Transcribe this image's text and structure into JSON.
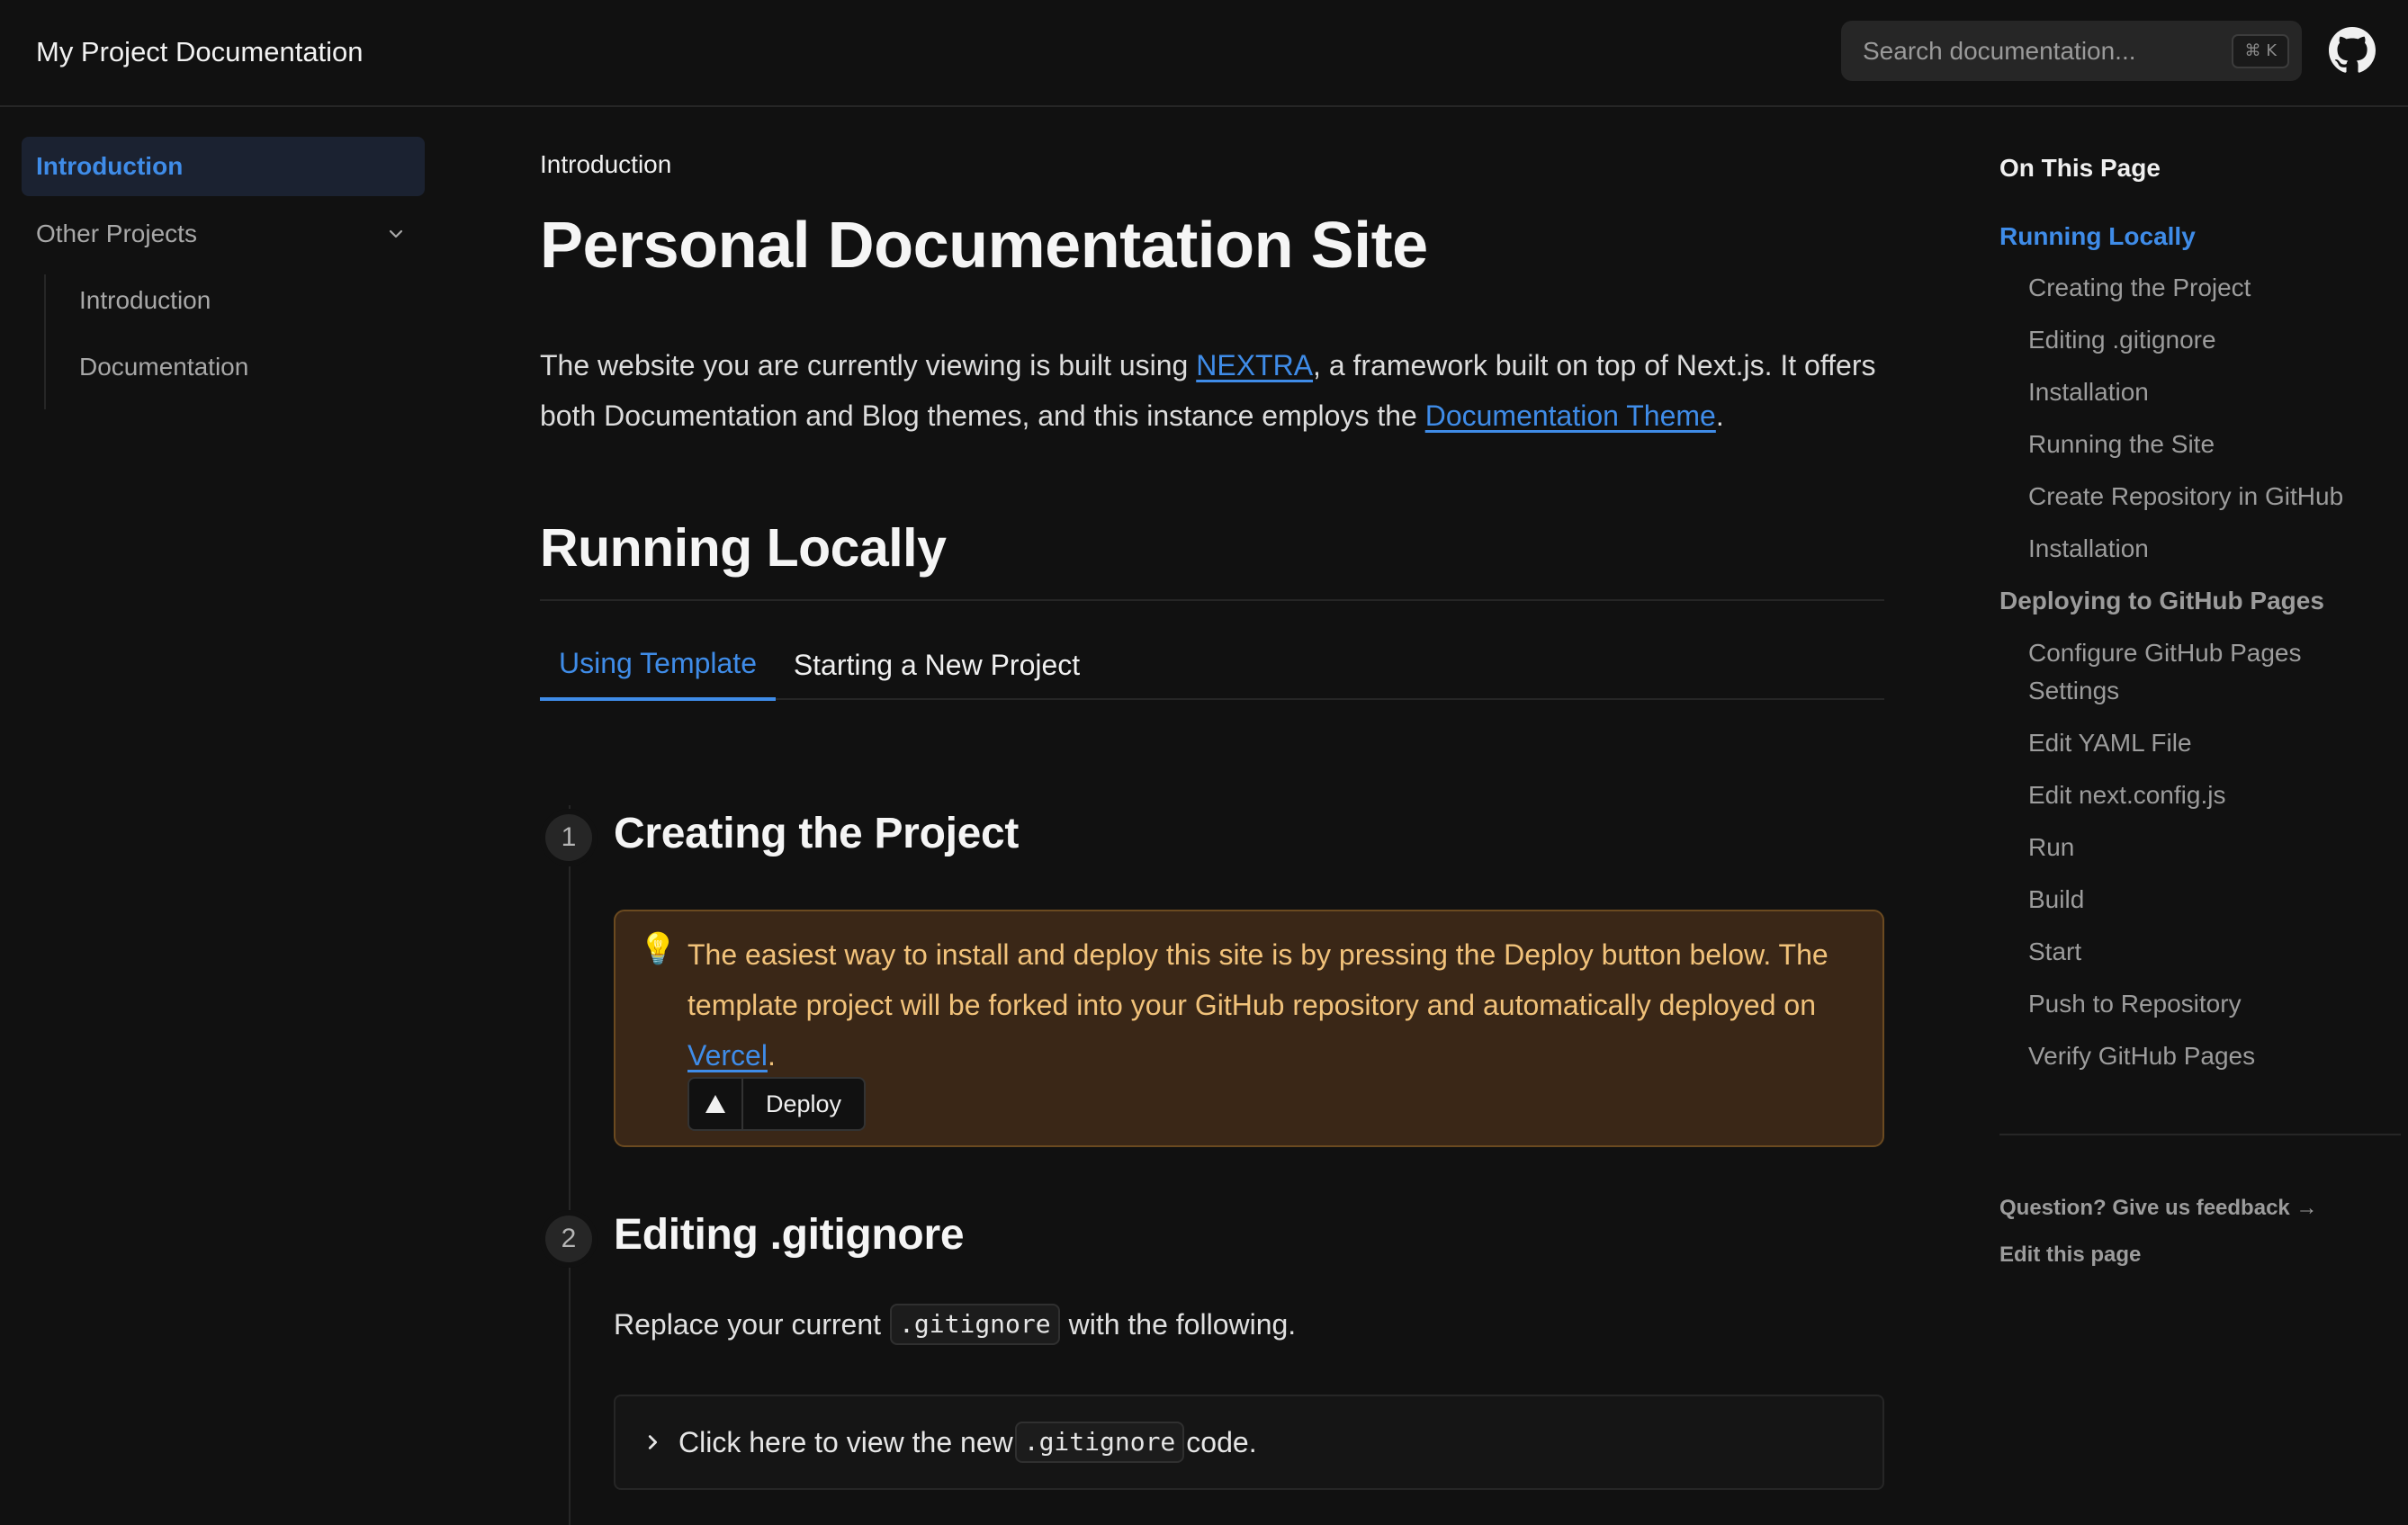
{
  "navbar": {
    "site_title": "My Project Documentation",
    "search_placeholder": "Search documentation...",
    "search_shortcut": "⌘ K",
    "github_icon": "github-icon"
  },
  "sidebar": {
    "items": [
      {
        "label": "Introduction",
        "active": true
      },
      {
        "label": "Other Projects",
        "expandable": true,
        "expanded": true,
        "children": [
          {
            "label": "Introduction"
          },
          {
            "label": "Documentation"
          }
        ]
      }
    ]
  },
  "main": {
    "breadcrumb": "Introduction",
    "title": "Personal Documentation Site",
    "intro": {
      "part1": "The website you are currently viewing is built using ",
      "link1": "NEXTRA",
      "part2": ", a framework built on top of Next.js. It offers both Documentation and Blog themes, and this instance employs the ",
      "link2": "Documentation Theme",
      "part3": "."
    },
    "section_title": "Running Locally",
    "tabs": [
      {
        "label": "Using Template",
        "active": true
      },
      {
        "label": "Starting a New Project",
        "active": false
      }
    ],
    "steps": [
      {
        "number": "1",
        "title": "Creating the Project",
        "callout": {
          "icon": "💡",
          "text": "The easiest way to install and deploy this site is by pressing the Deploy button below. The template project will be forked into your GitHub repository and automatically deployed on ",
          "link": "Vercel",
          "end": ".",
          "button_label": "Deploy",
          "accent": "#f1c27a"
        }
      },
      {
        "number": "2",
        "title": "Editing .gitignore",
        "text_before": "Replace your current",
        "code": ".gitignore",
        "text_after": "with the following.",
        "details": {
          "before": "Click here to view the new",
          "code": ".gitignore",
          "after": "code."
        }
      }
    ]
  },
  "toc": {
    "title": "On This Page",
    "items": [
      {
        "label": "Running Locally",
        "level": 1,
        "active": true
      },
      {
        "label": "Creating the Project",
        "level": 2
      },
      {
        "label": "Editing .gitignore",
        "level": 2
      },
      {
        "label": "Installation",
        "level": 2
      },
      {
        "label": "Running the Site",
        "level": 2
      },
      {
        "label": "Create Repository in GitHub",
        "level": 2
      },
      {
        "label": "Installation",
        "level": 2
      },
      {
        "label": "Deploying to GitHub Pages",
        "level": 1
      },
      {
        "label": "Configure GitHub Pages",
        "level": 2
      },
      {
        "label": "Settings",
        "level": 2
      },
      {
        "label": "Edit YAML File",
        "level": 2
      },
      {
        "label": "Edit next.config.js",
        "level": 2
      },
      {
        "label": "Run",
        "level": 2
      },
      {
        "label": "Build",
        "level": 2
      },
      {
        "label": "Start",
        "level": 2
      },
      {
        "label": "Push to Repository",
        "level": 2
      },
      {
        "label": "Verify GitHub Pages",
        "level": 2
      }
    ],
    "feedback": "Question? Give us feedback →",
    "edit": "Edit this page"
  },
  "colors": {
    "background": "#111111",
    "accent": "#3f8ce8",
    "callout_bg": "#3a2717",
    "callout_text": "#f1c27a"
  }
}
